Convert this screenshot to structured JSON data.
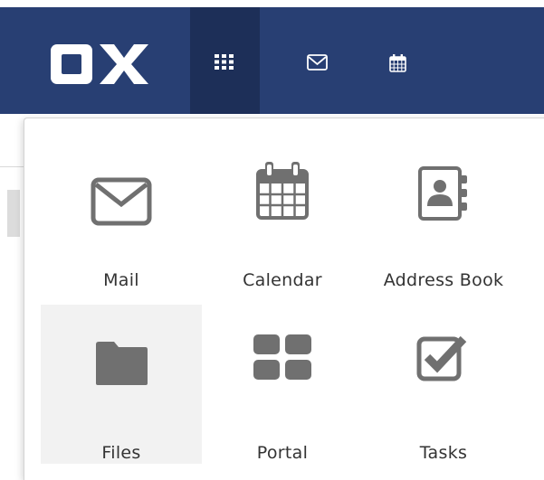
{
  "brand": {
    "logo_text": "OX",
    "topbar_color": "#283f73",
    "launcher_active_color": "#1d2f58"
  },
  "topbar": {
    "icons": [
      "apps-grid-icon",
      "mail-icon",
      "calendar-icon"
    ]
  },
  "launcher": {
    "apps": [
      {
        "label": "Mail",
        "icon": "envelope-icon"
      },
      {
        "label": "Calendar",
        "icon": "calendar-icon"
      },
      {
        "label": "Address Book",
        "icon": "address-book-icon"
      },
      {
        "label": "Files",
        "icon": "folder-icon",
        "highlighted": true
      },
      {
        "label": "Portal",
        "icon": "portal-grid-icon"
      },
      {
        "label": "Tasks",
        "icon": "checkbox-icon"
      }
    ]
  }
}
